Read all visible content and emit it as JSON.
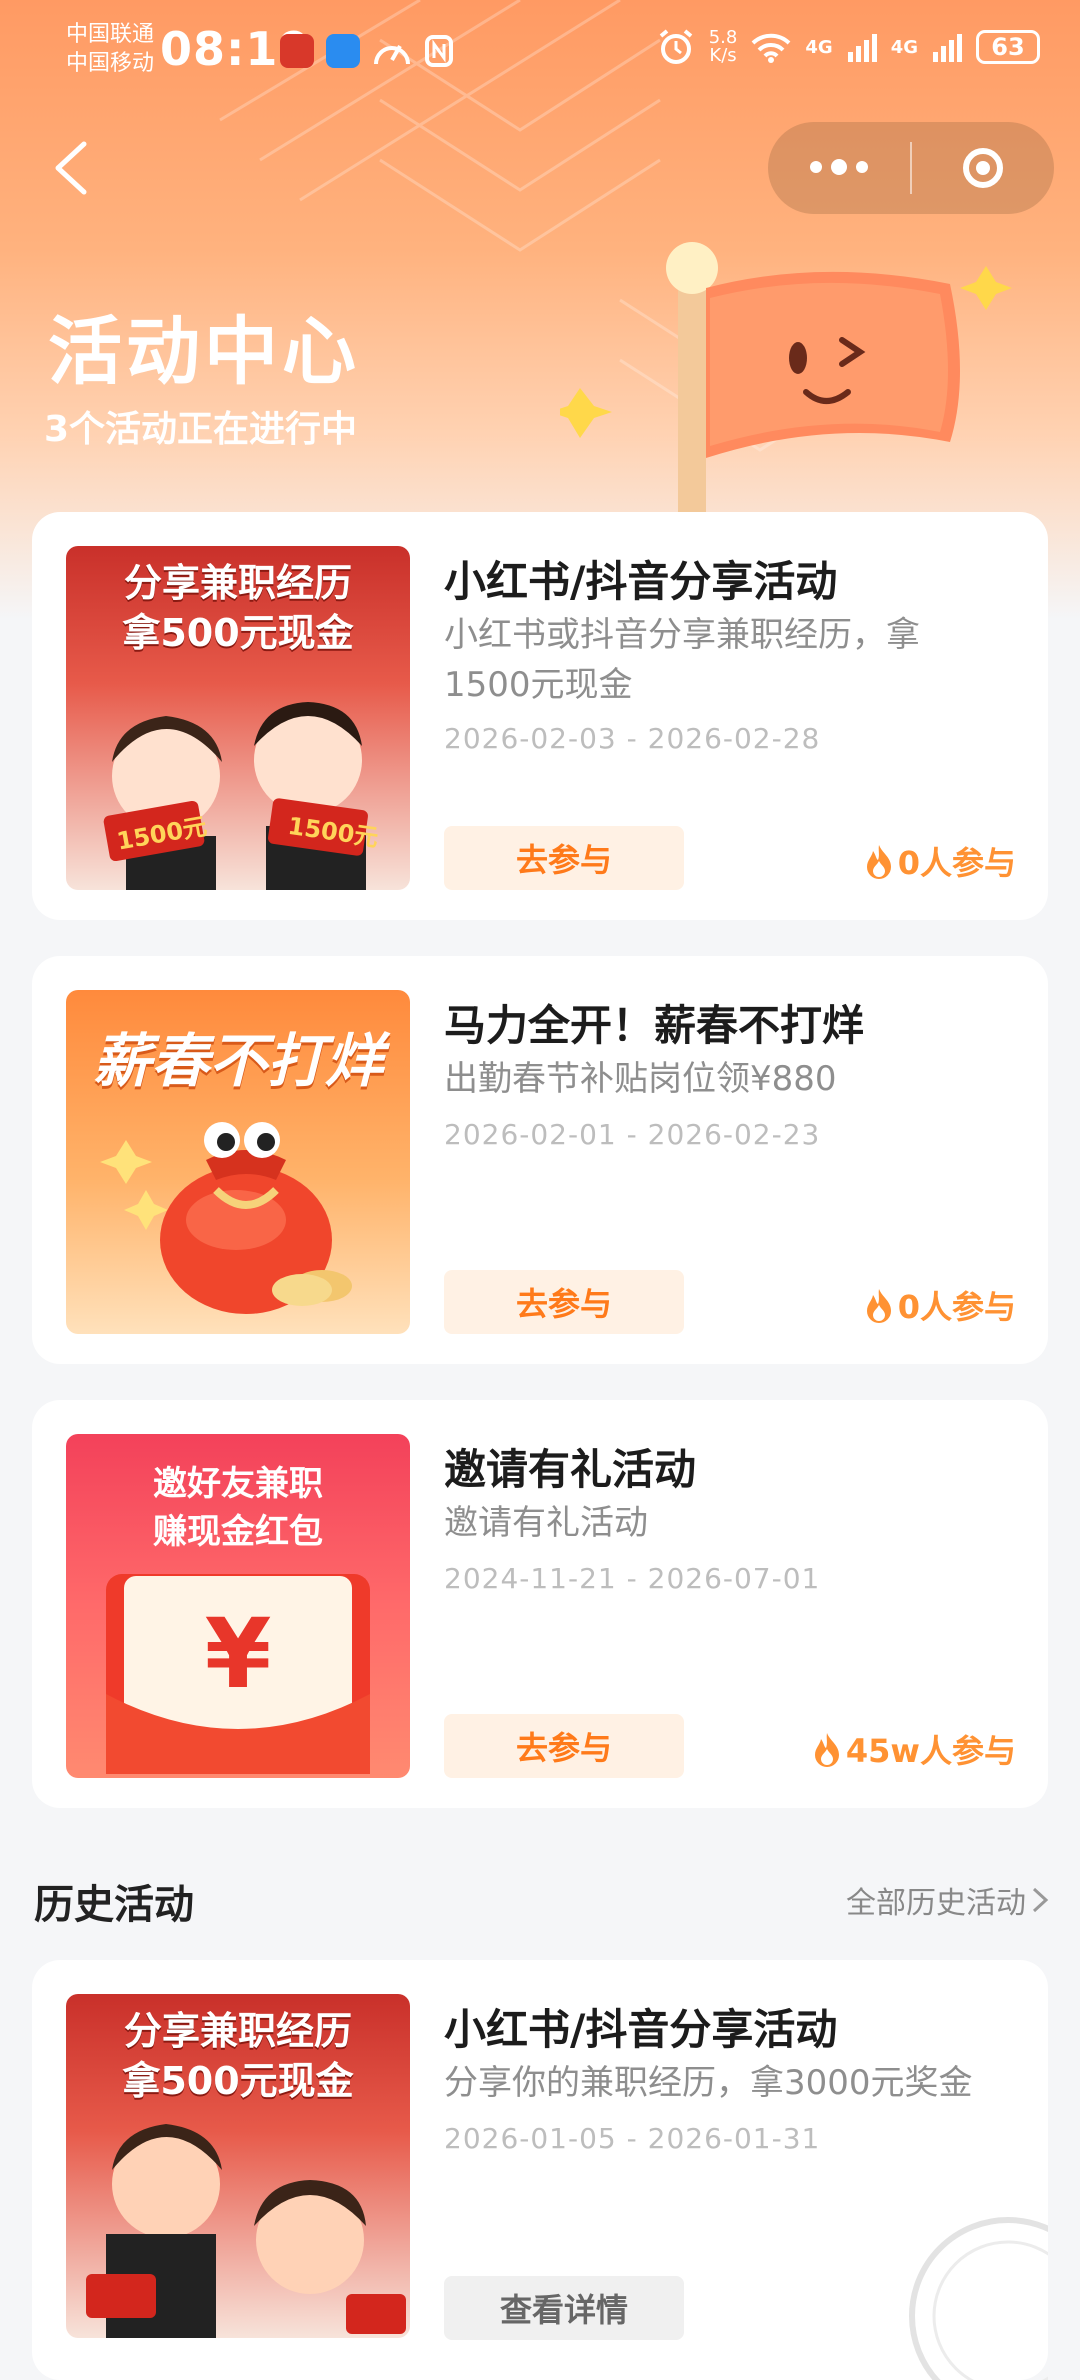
{
  "status_bar": {
    "carrier_1": "中国联通",
    "carrier_2": "中国移动",
    "time": "08:19",
    "net_speed_value": "5.8",
    "net_speed_unit": "K/s",
    "signal_1": "4G",
    "signal_2": "4G",
    "battery": "63"
  },
  "nav": {
    "back_icon": "chevron-left-icon",
    "more_icon": "more-dots-icon",
    "close_icon": "target-close-icon"
  },
  "header": {
    "title": "活动中心",
    "subtitle": "3个活动正在进行中"
  },
  "activities": [
    {
      "title": "小红书/抖音分享活动",
      "desc": "小红书或抖音分享兼职经历，拿1500元现金",
      "date": "2026-02-03 - 2026-02-28",
      "button": "去参与",
      "participants": "0人参与",
      "thumb_text_1": "分享兼职经历",
      "thumb_text_2": "拿500元现金",
      "thumb_envelope": "1500元"
    },
    {
      "title": "马力全开！薪春不打烊",
      "desc": "出勤春节补贴岗位领¥880",
      "date": "2026-02-01 - 2026-02-23",
      "button": "去参与",
      "participants": "0人参与",
      "thumb_text_1": "薪春不打烊"
    },
    {
      "title": "邀请有礼活动",
      "desc": "邀请有礼活动",
      "date": "2024-11-21 - 2026-07-01",
      "button": "去参与",
      "participants": "45w人参与",
      "thumb_text_1": "邀好友兼职",
      "thumb_text_2": "赚现金红包",
      "thumb_symbol": "¥"
    }
  ],
  "history": {
    "title": "历史活动",
    "all_link": "全部历史活动",
    "items": [
      {
        "title": "小红书/抖音分享活动",
        "desc": "分享你的兼职经历，拿3000元奖金",
        "date": "2026-01-05 - 2026-01-31",
        "button": "查看详情",
        "thumb_text_1": "分享兼职经历",
        "thumb_text_2": "拿500元现金"
      }
    ]
  },
  "colors": {
    "accent": "#ff7a1a",
    "button_bg": "#fff1e4",
    "header_gradient_top": "#ff9a63"
  }
}
